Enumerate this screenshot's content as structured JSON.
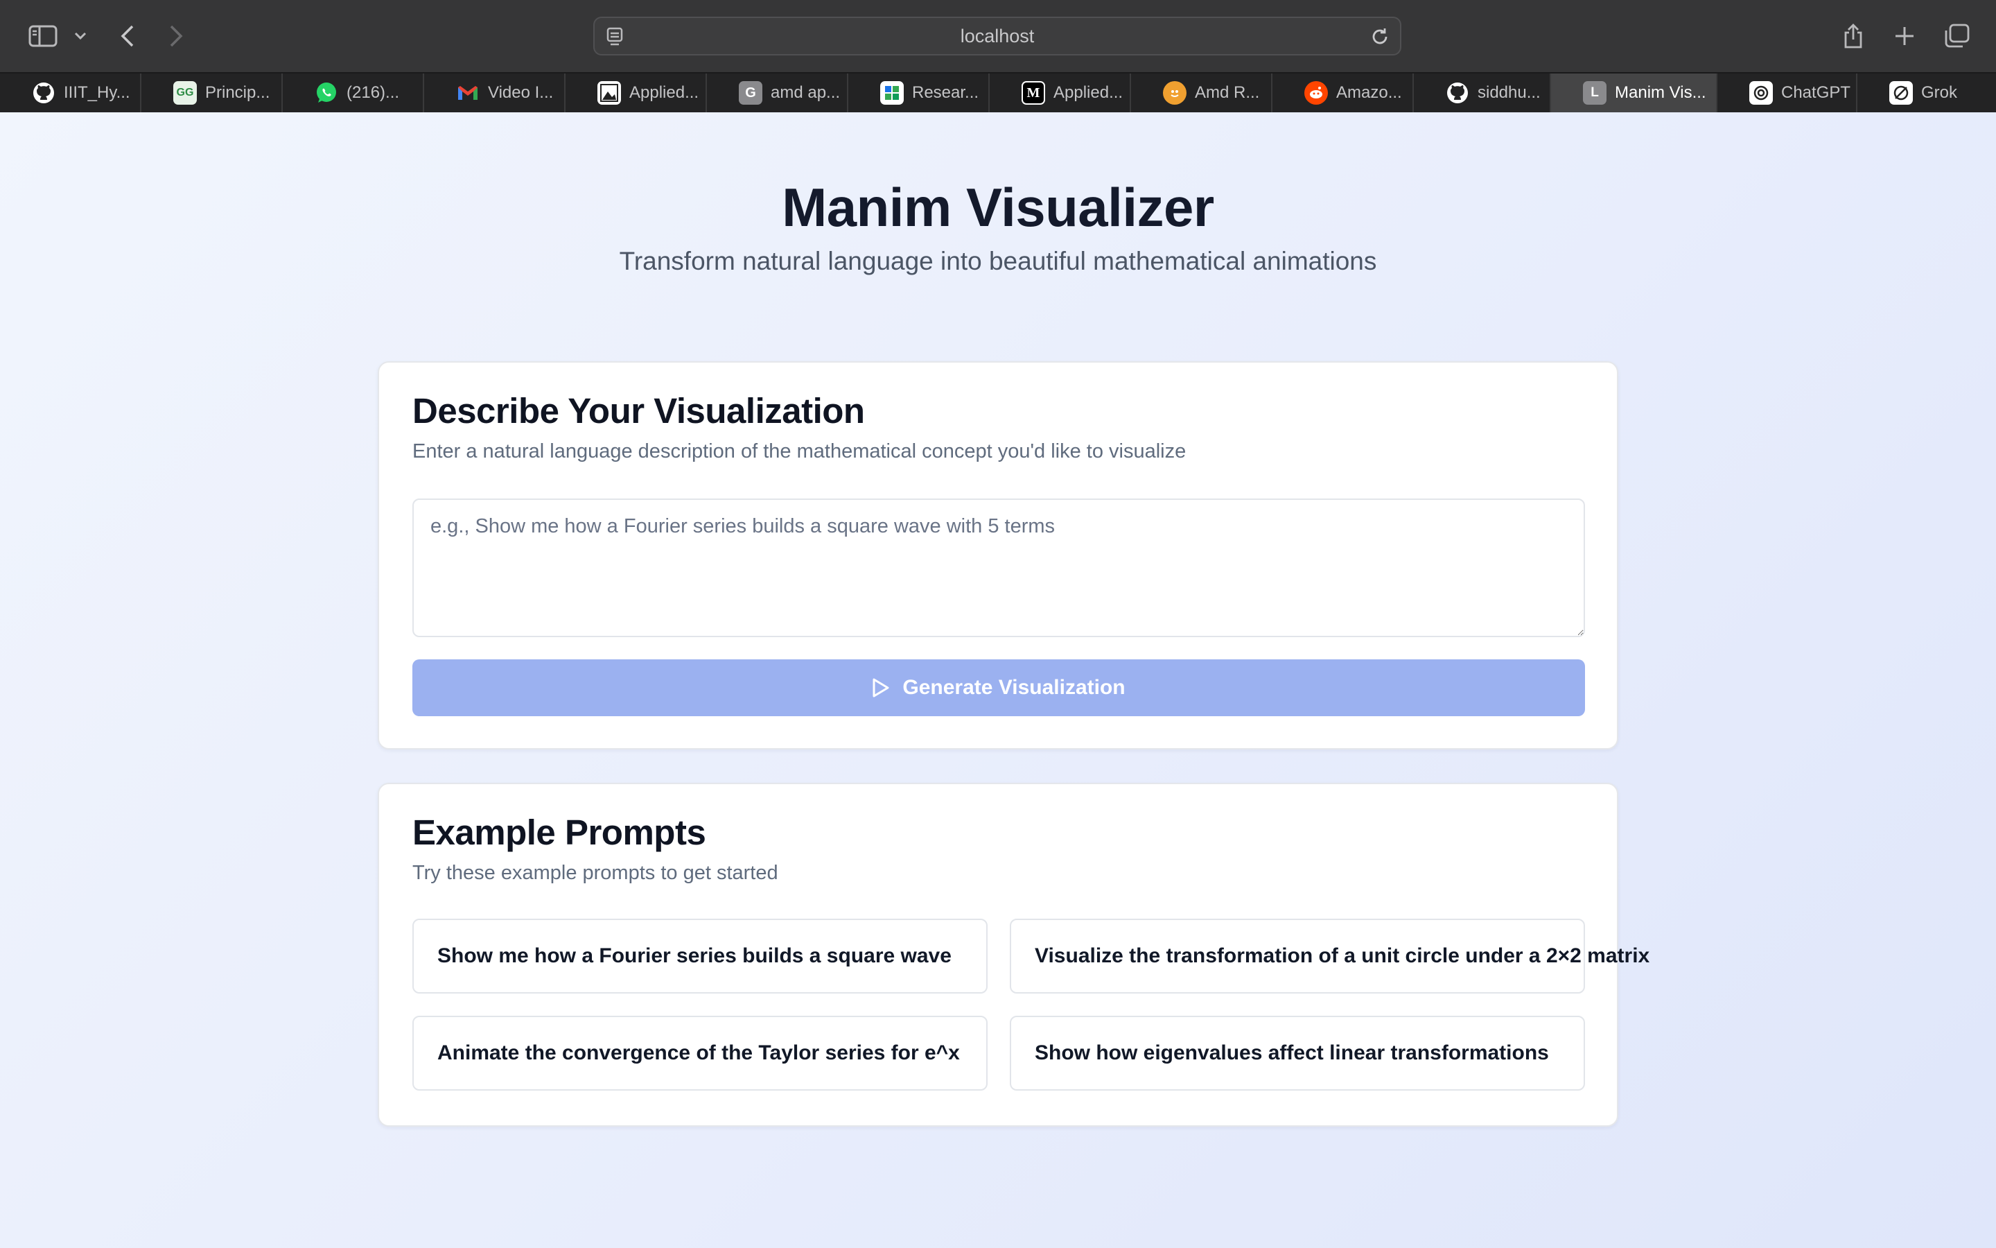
{
  "browser": {
    "url": "localhost",
    "tabs": [
      {
        "title": "IIIT_Hy...",
        "icon": "github-icon"
      },
      {
        "title": "Princip...",
        "icon": "geeksforgeeks-icon"
      },
      {
        "title": "(216)...",
        "icon": "whatsapp-icon"
      },
      {
        "title": "Video I...",
        "icon": "gmail-icon"
      },
      {
        "title": "Applied...",
        "icon": "applied-icon"
      },
      {
        "title": "amd ap...",
        "icon": "google-icon"
      },
      {
        "title": "Resear...",
        "icon": "research-icon"
      },
      {
        "title": "Applied...",
        "icon": "medium-icon"
      },
      {
        "title": "Amd R...",
        "icon": "amd-icon"
      },
      {
        "title": "Amazo...",
        "icon": "reddit-icon"
      },
      {
        "title": "siddhu...",
        "icon": "github-icon"
      },
      {
        "title": "Manim Vis...",
        "icon": "letter-l-icon",
        "active": true
      },
      {
        "title": "ChatGPT",
        "icon": "chatgpt-icon"
      },
      {
        "title": "Grok",
        "icon": "grok-icon"
      }
    ],
    "favicon_letters": {
      "google": "G",
      "manim": "L",
      "medium": "M"
    }
  },
  "header": {
    "title": "Manim Visualizer",
    "subtitle": "Transform natural language into beautiful mathematical animations"
  },
  "describe": {
    "heading": "Describe Your Visualization",
    "subheading": "Enter a natural language description of the mathematical concept you'd like to visualize",
    "placeholder": "e.g., Show me how a Fourier series builds a square wave with 5 terms",
    "value": "",
    "button_label": "Generate Visualization"
  },
  "examples": {
    "heading": "Example Prompts",
    "subheading": "Try these example prompts to get started",
    "prompts": [
      "Show me how a Fourier series builds a square wave",
      "Visualize the transformation of a unit circle under a 2×2 matrix",
      "Animate the convergence of the Taylor series for e^x",
      "Show how eigenvalues affect linear transformations"
    ]
  },
  "colors": {
    "primary_button": "#9bb1f0",
    "title": "#141a2c",
    "chrome": "#363637"
  }
}
